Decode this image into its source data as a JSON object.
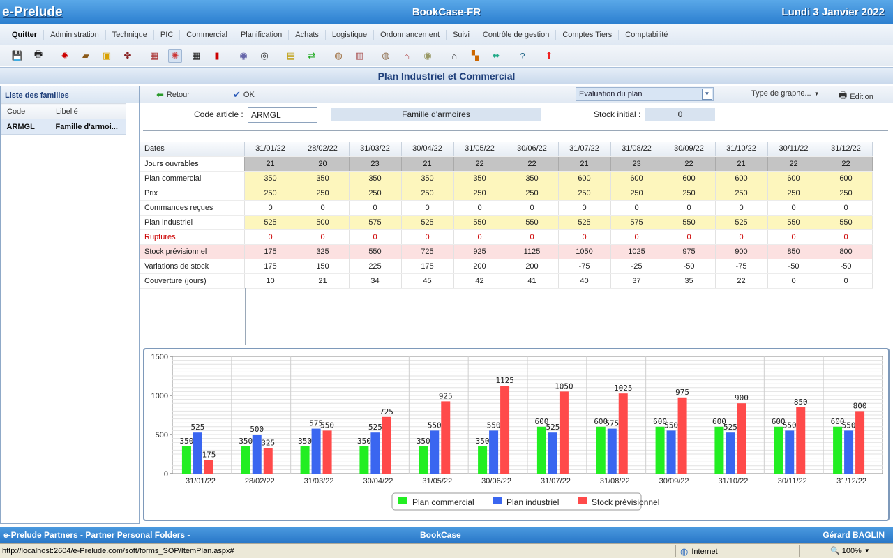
{
  "header": {
    "brand": "e-Prelude",
    "app": "BookCase-FR",
    "date": "Lundi 3 Janvier 2022"
  },
  "menu": [
    "Quitter",
    "Administration",
    "Technique",
    "PIC",
    "Commercial",
    "Planification",
    "Achats",
    "Logistique",
    "Ordonnancement",
    "Suivi",
    "Contrôle de gestion",
    "Comptes Tiers",
    "Comptabilité"
  ],
  "page_title": "Plan Industriel et Commercial",
  "left_panel": {
    "title": "Liste des familles",
    "col_code": "Code",
    "col_label": "Libellé",
    "rows": [
      {
        "code": "ARMGL",
        "label": "Famille d'armoi..."
      }
    ]
  },
  "actions": {
    "back": "Retour",
    "ok": "OK",
    "evaluation": "Evaluation du plan",
    "graph_type": "Type de graphe...",
    "edition": "Edition"
  },
  "form": {
    "code_label": "Code article :",
    "code_value": "ARMGL",
    "family": "Famille d'armoires",
    "stock_label": "Stock initial :",
    "stock_value": "0"
  },
  "grid": {
    "dates_label": "Dates",
    "dates": [
      "31/01/22",
      "28/02/22",
      "31/03/22",
      "30/04/22",
      "31/05/22",
      "30/06/22",
      "31/07/22",
      "31/08/22",
      "30/09/22",
      "31/10/22",
      "30/11/22",
      "31/12/22"
    ],
    "rows": [
      {
        "label": "Jours ouvrables",
        "style": "jours",
        "values": [
          "21",
          "20",
          "23",
          "21",
          "22",
          "22",
          "21",
          "23",
          "22",
          "21",
          "22",
          "22"
        ]
      },
      {
        "label": "Plan commercial",
        "style": "yellow",
        "values": [
          "350",
          "350",
          "350",
          "350",
          "350",
          "350",
          "600",
          "600",
          "600",
          "600",
          "600",
          "600"
        ]
      },
      {
        "label": "Prix",
        "style": "yellow",
        "values": [
          "250",
          "250",
          "250",
          "250",
          "250",
          "250",
          "250",
          "250",
          "250",
          "250",
          "250",
          "250"
        ]
      },
      {
        "label": "Commandes reçues",
        "style": "",
        "values": [
          "0",
          "0",
          "0",
          "0",
          "0",
          "0",
          "0",
          "0",
          "0",
          "0",
          "0",
          "0"
        ]
      },
      {
        "label": "Plan industriel",
        "style": "yellow",
        "values": [
          "525",
          "500",
          "575",
          "525",
          "550",
          "550",
          "525",
          "575",
          "550",
          "525",
          "550",
          "550"
        ]
      },
      {
        "label": "Ruptures",
        "style": "red",
        "values": [
          "0",
          "0",
          "0",
          "0",
          "0",
          "0",
          "0",
          "0",
          "0",
          "0",
          "0",
          "0"
        ]
      },
      {
        "label": "Stock prévisionnel",
        "style": "pink",
        "values": [
          "175",
          "325",
          "550",
          "725",
          "925",
          "1125",
          "1050",
          "1025",
          "975",
          "900",
          "850",
          "800"
        ]
      },
      {
        "label": "Variations de stock",
        "style": "",
        "values": [
          "175",
          "150",
          "225",
          "175",
          "200",
          "200",
          "-75",
          "-25",
          "-50",
          "-75",
          "-50",
          "-50"
        ]
      },
      {
        "label": "Couverture (jours)",
        "style": "",
        "values": [
          "10",
          "21",
          "34",
          "45",
          "42",
          "41",
          "40",
          "37",
          "35",
          "22",
          "0",
          "0"
        ]
      }
    ]
  },
  "chart_data": {
    "type": "bar",
    "categories": [
      "31/01/22",
      "28/02/22",
      "31/03/22",
      "30/04/22",
      "31/05/22",
      "30/06/22",
      "31/07/22",
      "31/08/22",
      "30/09/22",
      "31/10/22",
      "30/11/22",
      "31/12/22"
    ],
    "series": [
      {
        "name": "Plan commercial",
        "color": "#22ee22",
        "values": [
          350,
          350,
          350,
          350,
          350,
          350,
          600,
          600,
          600,
          600,
          600,
          600
        ]
      },
      {
        "name": "Plan industriel",
        "color": "#3a66f0",
        "values": [
          525,
          500,
          575,
          525,
          550,
          550,
          525,
          575,
          550,
          525,
          550,
          550
        ]
      },
      {
        "name": "Stock prévisionnel",
        "color": "#ff4a4a",
        "values": [
          175,
          325,
          550,
          725,
          925,
          1125,
          1050,
          1025,
          975,
          900,
          850,
          800
        ]
      }
    ],
    "yticks": [
      0,
      500,
      1000,
      1500
    ],
    "ylim": [
      0,
      1500
    ],
    "grid": true,
    "legend": "bottom"
  },
  "footer": {
    "left": "e-Prelude Partners - Partner Personal Folders -",
    "center": "BookCase",
    "right": "Gérard BAGLIN"
  },
  "status": {
    "url": "http://localhost:2604/e-Prelude.com/soft/forms_SOP/ItemPlan.aspx#",
    "zone": "Internet",
    "zoom": "100%"
  }
}
